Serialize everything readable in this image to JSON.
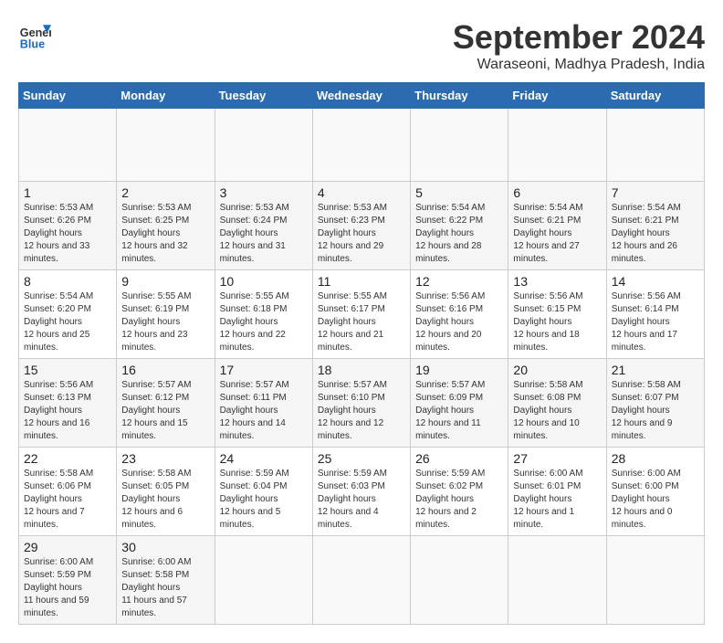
{
  "header": {
    "logo_line1": "General",
    "logo_line2": "Blue",
    "month_title": "September 2024",
    "location": "Waraseoni, Madhya Pradesh, India"
  },
  "calendar": {
    "days_of_week": [
      "Sunday",
      "Monday",
      "Tuesday",
      "Wednesday",
      "Thursday",
      "Friday",
      "Saturday"
    ],
    "weeks": [
      [
        {
          "day": "",
          "empty": true
        },
        {
          "day": "",
          "empty": true
        },
        {
          "day": "",
          "empty": true
        },
        {
          "day": "",
          "empty": true
        },
        {
          "day": "",
          "empty": true
        },
        {
          "day": "",
          "empty": true
        },
        {
          "day": "",
          "empty": true
        }
      ],
      [
        {
          "day": "1",
          "sunrise": "5:53 AM",
          "sunset": "6:26 PM",
          "daylight": "12 hours and 33 minutes."
        },
        {
          "day": "2",
          "sunrise": "5:53 AM",
          "sunset": "6:25 PM",
          "daylight": "12 hours and 32 minutes."
        },
        {
          "day": "3",
          "sunrise": "5:53 AM",
          "sunset": "6:24 PM",
          "daylight": "12 hours and 31 minutes."
        },
        {
          "day": "4",
          "sunrise": "5:53 AM",
          "sunset": "6:23 PM",
          "daylight": "12 hours and 29 minutes."
        },
        {
          "day": "5",
          "sunrise": "5:54 AM",
          "sunset": "6:22 PM",
          "daylight": "12 hours and 28 minutes."
        },
        {
          "day": "6",
          "sunrise": "5:54 AM",
          "sunset": "6:21 PM",
          "daylight": "12 hours and 27 minutes."
        },
        {
          "day": "7",
          "sunrise": "5:54 AM",
          "sunset": "6:21 PM",
          "daylight": "12 hours and 26 minutes."
        }
      ],
      [
        {
          "day": "8",
          "sunrise": "5:54 AM",
          "sunset": "6:20 PM",
          "daylight": "12 hours and 25 minutes."
        },
        {
          "day": "9",
          "sunrise": "5:55 AM",
          "sunset": "6:19 PM",
          "daylight": "12 hours and 23 minutes."
        },
        {
          "day": "10",
          "sunrise": "5:55 AM",
          "sunset": "6:18 PM",
          "daylight": "12 hours and 22 minutes."
        },
        {
          "day": "11",
          "sunrise": "5:55 AM",
          "sunset": "6:17 PM",
          "daylight": "12 hours and 21 minutes."
        },
        {
          "day": "12",
          "sunrise": "5:56 AM",
          "sunset": "6:16 PM",
          "daylight": "12 hours and 20 minutes."
        },
        {
          "day": "13",
          "sunrise": "5:56 AM",
          "sunset": "6:15 PM",
          "daylight": "12 hours and 18 minutes."
        },
        {
          "day": "14",
          "sunrise": "5:56 AM",
          "sunset": "6:14 PM",
          "daylight": "12 hours and 17 minutes."
        }
      ],
      [
        {
          "day": "15",
          "sunrise": "5:56 AM",
          "sunset": "6:13 PM",
          "daylight": "12 hours and 16 minutes."
        },
        {
          "day": "16",
          "sunrise": "5:57 AM",
          "sunset": "6:12 PM",
          "daylight": "12 hours and 15 minutes."
        },
        {
          "day": "17",
          "sunrise": "5:57 AM",
          "sunset": "6:11 PM",
          "daylight": "12 hours and 14 minutes."
        },
        {
          "day": "18",
          "sunrise": "5:57 AM",
          "sunset": "6:10 PM",
          "daylight": "12 hours and 12 minutes."
        },
        {
          "day": "19",
          "sunrise": "5:57 AM",
          "sunset": "6:09 PM",
          "daylight": "12 hours and 11 minutes."
        },
        {
          "day": "20",
          "sunrise": "5:58 AM",
          "sunset": "6:08 PM",
          "daylight": "12 hours and 10 minutes."
        },
        {
          "day": "21",
          "sunrise": "5:58 AM",
          "sunset": "6:07 PM",
          "daylight": "12 hours and 9 minutes."
        }
      ],
      [
        {
          "day": "22",
          "sunrise": "5:58 AM",
          "sunset": "6:06 PM",
          "daylight": "12 hours and 7 minutes."
        },
        {
          "day": "23",
          "sunrise": "5:58 AM",
          "sunset": "6:05 PM",
          "daylight": "12 hours and 6 minutes."
        },
        {
          "day": "24",
          "sunrise": "5:59 AM",
          "sunset": "6:04 PM",
          "daylight": "12 hours and 5 minutes."
        },
        {
          "day": "25",
          "sunrise": "5:59 AM",
          "sunset": "6:03 PM",
          "daylight": "12 hours and 4 minutes."
        },
        {
          "day": "26",
          "sunrise": "5:59 AM",
          "sunset": "6:02 PM",
          "daylight": "12 hours and 2 minutes."
        },
        {
          "day": "27",
          "sunrise": "6:00 AM",
          "sunset": "6:01 PM",
          "daylight": "12 hours and 1 minute."
        },
        {
          "day": "28",
          "sunrise": "6:00 AM",
          "sunset": "6:00 PM",
          "daylight": "12 hours and 0 minutes."
        }
      ],
      [
        {
          "day": "29",
          "sunrise": "6:00 AM",
          "sunset": "5:59 PM",
          "daylight": "11 hours and 59 minutes."
        },
        {
          "day": "30",
          "sunrise": "6:00 AM",
          "sunset": "5:58 PM",
          "daylight": "11 hours and 57 minutes."
        },
        {
          "day": "",
          "empty": true
        },
        {
          "day": "",
          "empty": true
        },
        {
          "day": "",
          "empty": true
        },
        {
          "day": "",
          "empty": true
        },
        {
          "day": "",
          "empty": true
        }
      ]
    ]
  }
}
